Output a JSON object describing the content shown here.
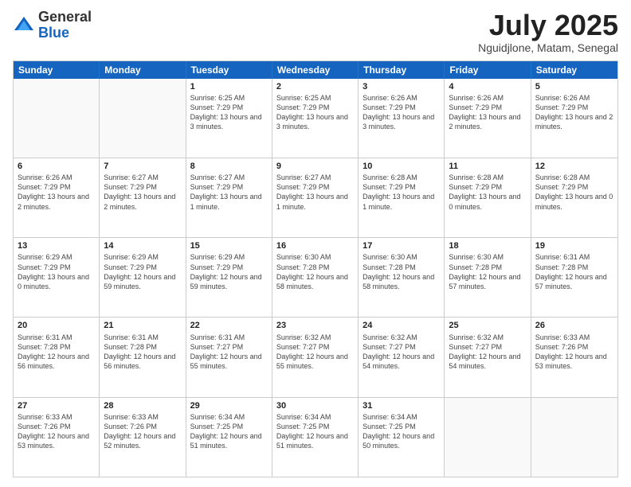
{
  "header": {
    "logo": {
      "general": "General",
      "blue": "Blue"
    },
    "title": "July 2025",
    "location": "Nguidjlone, Matam, Senegal"
  },
  "days_of_week": [
    "Sunday",
    "Monday",
    "Tuesday",
    "Wednesday",
    "Thursday",
    "Friday",
    "Saturday"
  ],
  "weeks": [
    [
      {
        "day": "",
        "empty": true,
        "info": ""
      },
      {
        "day": "",
        "empty": true,
        "info": ""
      },
      {
        "day": "1",
        "info": "Sunrise: 6:25 AM\nSunset: 7:29 PM\nDaylight: 13 hours and 3 minutes."
      },
      {
        "day": "2",
        "info": "Sunrise: 6:25 AM\nSunset: 7:29 PM\nDaylight: 13 hours and 3 minutes."
      },
      {
        "day": "3",
        "info": "Sunrise: 6:26 AM\nSunset: 7:29 PM\nDaylight: 13 hours and 3 minutes."
      },
      {
        "day": "4",
        "info": "Sunrise: 6:26 AM\nSunset: 7:29 PM\nDaylight: 13 hours and 2 minutes."
      },
      {
        "day": "5",
        "info": "Sunrise: 6:26 AM\nSunset: 7:29 PM\nDaylight: 13 hours and 2 minutes."
      }
    ],
    [
      {
        "day": "6",
        "info": "Sunrise: 6:26 AM\nSunset: 7:29 PM\nDaylight: 13 hours and 2 minutes."
      },
      {
        "day": "7",
        "info": "Sunrise: 6:27 AM\nSunset: 7:29 PM\nDaylight: 13 hours and 2 minutes."
      },
      {
        "day": "8",
        "info": "Sunrise: 6:27 AM\nSunset: 7:29 PM\nDaylight: 13 hours and 1 minute."
      },
      {
        "day": "9",
        "info": "Sunrise: 6:27 AM\nSunset: 7:29 PM\nDaylight: 13 hours and 1 minute."
      },
      {
        "day": "10",
        "info": "Sunrise: 6:28 AM\nSunset: 7:29 PM\nDaylight: 13 hours and 1 minute."
      },
      {
        "day": "11",
        "info": "Sunrise: 6:28 AM\nSunset: 7:29 PM\nDaylight: 13 hours and 0 minutes."
      },
      {
        "day": "12",
        "info": "Sunrise: 6:28 AM\nSunset: 7:29 PM\nDaylight: 13 hours and 0 minutes."
      }
    ],
    [
      {
        "day": "13",
        "info": "Sunrise: 6:29 AM\nSunset: 7:29 PM\nDaylight: 13 hours and 0 minutes."
      },
      {
        "day": "14",
        "info": "Sunrise: 6:29 AM\nSunset: 7:29 PM\nDaylight: 12 hours and 59 minutes."
      },
      {
        "day": "15",
        "info": "Sunrise: 6:29 AM\nSunset: 7:29 PM\nDaylight: 12 hours and 59 minutes."
      },
      {
        "day": "16",
        "info": "Sunrise: 6:30 AM\nSunset: 7:28 PM\nDaylight: 12 hours and 58 minutes."
      },
      {
        "day": "17",
        "info": "Sunrise: 6:30 AM\nSunset: 7:28 PM\nDaylight: 12 hours and 58 minutes."
      },
      {
        "day": "18",
        "info": "Sunrise: 6:30 AM\nSunset: 7:28 PM\nDaylight: 12 hours and 57 minutes."
      },
      {
        "day": "19",
        "info": "Sunrise: 6:31 AM\nSunset: 7:28 PM\nDaylight: 12 hours and 57 minutes."
      }
    ],
    [
      {
        "day": "20",
        "info": "Sunrise: 6:31 AM\nSunset: 7:28 PM\nDaylight: 12 hours and 56 minutes."
      },
      {
        "day": "21",
        "info": "Sunrise: 6:31 AM\nSunset: 7:28 PM\nDaylight: 12 hours and 56 minutes."
      },
      {
        "day": "22",
        "info": "Sunrise: 6:31 AM\nSunset: 7:27 PM\nDaylight: 12 hours and 55 minutes."
      },
      {
        "day": "23",
        "info": "Sunrise: 6:32 AM\nSunset: 7:27 PM\nDaylight: 12 hours and 55 minutes."
      },
      {
        "day": "24",
        "info": "Sunrise: 6:32 AM\nSunset: 7:27 PM\nDaylight: 12 hours and 54 minutes."
      },
      {
        "day": "25",
        "info": "Sunrise: 6:32 AM\nSunset: 7:27 PM\nDaylight: 12 hours and 54 minutes."
      },
      {
        "day": "26",
        "info": "Sunrise: 6:33 AM\nSunset: 7:26 PM\nDaylight: 12 hours and 53 minutes."
      }
    ],
    [
      {
        "day": "27",
        "info": "Sunrise: 6:33 AM\nSunset: 7:26 PM\nDaylight: 12 hours and 53 minutes."
      },
      {
        "day": "28",
        "info": "Sunrise: 6:33 AM\nSunset: 7:26 PM\nDaylight: 12 hours and 52 minutes."
      },
      {
        "day": "29",
        "info": "Sunrise: 6:34 AM\nSunset: 7:25 PM\nDaylight: 12 hours and 51 minutes."
      },
      {
        "day": "30",
        "info": "Sunrise: 6:34 AM\nSunset: 7:25 PM\nDaylight: 12 hours and 51 minutes."
      },
      {
        "day": "31",
        "info": "Sunrise: 6:34 AM\nSunset: 7:25 PM\nDaylight: 12 hours and 50 minutes."
      },
      {
        "day": "",
        "empty": true,
        "info": ""
      },
      {
        "day": "",
        "empty": true,
        "info": ""
      }
    ]
  ]
}
